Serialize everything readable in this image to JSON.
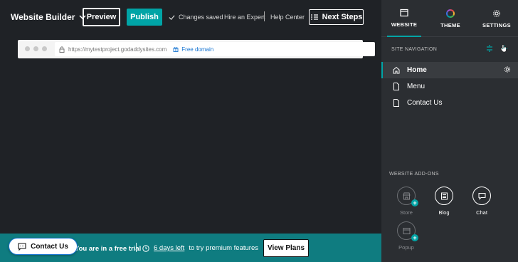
{
  "header": {
    "brand": "Website Builder",
    "preview_label": "Preview",
    "publish_label": "Publish",
    "saved_status": "Changes saved",
    "hire_expert": "Hire an Expert",
    "help_center": "Help Center",
    "next_steps": "Next Steps"
  },
  "browser": {
    "url": "https://mytestproject.godaddysites.com",
    "free_domain": "Free domain"
  },
  "panel": {
    "tabs": [
      {
        "label": "WEBSITE",
        "icon": "browser-icon",
        "active": true
      },
      {
        "label": "THEME",
        "icon": "color-wheel-icon",
        "active": false
      },
      {
        "label": "SETTINGS",
        "icon": "gear-icon",
        "active": false
      }
    ],
    "site_nav_title": "SITE NAVIGATION",
    "nav_items": [
      {
        "label": "Home",
        "icon": "home-icon",
        "selected": true
      },
      {
        "label": "Menu",
        "icon": "page-icon",
        "selected": false
      },
      {
        "label": "Contact Us",
        "icon": "page-icon",
        "selected": false
      }
    ],
    "addons_title": "WEBSITE ADD-ONS",
    "addons": [
      {
        "label": "Store",
        "icon": "store-icon",
        "enabled": false
      },
      {
        "label": "Blog",
        "icon": "blog-icon",
        "enabled": true
      },
      {
        "label": "Chat",
        "icon": "chat-icon",
        "enabled": true
      },
      {
        "label": "Popup",
        "icon": "popup-icon",
        "enabled": false
      }
    ]
  },
  "footer": {
    "contact_label": "Contact Us",
    "trial_text": "You are in a free trial",
    "days_left": "6 days left",
    "premium_text": "to try premium features",
    "view_plans": "View Plans"
  },
  "colors": {
    "accent": "#00a4a6",
    "banner": "#0f7c80",
    "panel_bg": "#2b2e32",
    "canvas_bg": "#1f2226"
  }
}
